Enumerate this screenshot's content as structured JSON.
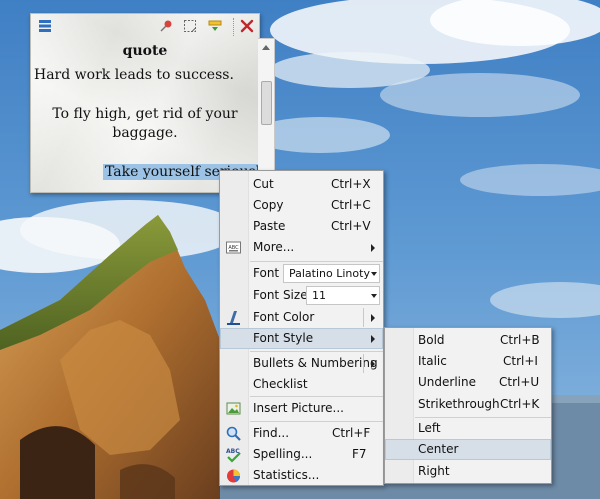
{
  "note": {
    "title": "quote",
    "line1": "Hard work leads to success.",
    "line2": "To fly high, get rid of your",
    "line3": "baggage.",
    "line4": "Take yourself seriously"
  },
  "toolbar": {
    "icons": [
      "list-icon",
      "pin-icon",
      "note-icon",
      "roll-up-icon",
      "close-icon"
    ]
  },
  "context_menu": {
    "cut": {
      "label": "Cut",
      "shortcut": "Ctrl+X"
    },
    "copy": {
      "label": "Copy",
      "shortcut": "Ctrl+C"
    },
    "paste": {
      "label": "Paste",
      "shortcut": "Ctrl+V"
    },
    "more": {
      "label": "More..."
    },
    "font": {
      "label": "Font",
      "value": "Palatino Linotype"
    },
    "font_size": {
      "label": "Font Size",
      "value": "11"
    },
    "font_color": {
      "label": "Font Color"
    },
    "font_style": {
      "label": "Font Style"
    },
    "bullets": {
      "label": "Bullets & Numbering"
    },
    "checklist": {
      "label": "Checklist"
    },
    "insert_picture": {
      "label": "Insert Picture..."
    },
    "find": {
      "label": "Find...",
      "shortcut": "Ctrl+F"
    },
    "spelling": {
      "label": "Spelling...",
      "shortcut": "F7"
    },
    "statistics": {
      "label": "Statistics..."
    }
  },
  "submenu": {
    "bold": {
      "label": "Bold",
      "shortcut": "Ctrl+B"
    },
    "italic": {
      "label": "Italic",
      "shortcut": "Ctrl+I"
    },
    "underline": {
      "label": "Underline",
      "shortcut": "Ctrl+U"
    },
    "strikethrough": {
      "label": "Strikethrough",
      "shortcut": "Ctrl+K"
    },
    "left": {
      "label": "Left"
    },
    "center": {
      "label": "Center"
    },
    "right": {
      "label": "Right"
    }
  },
  "colors": {
    "highlight": "#d6dfe7",
    "selection": "#9cc3e6",
    "close_red": "#c0272d"
  }
}
